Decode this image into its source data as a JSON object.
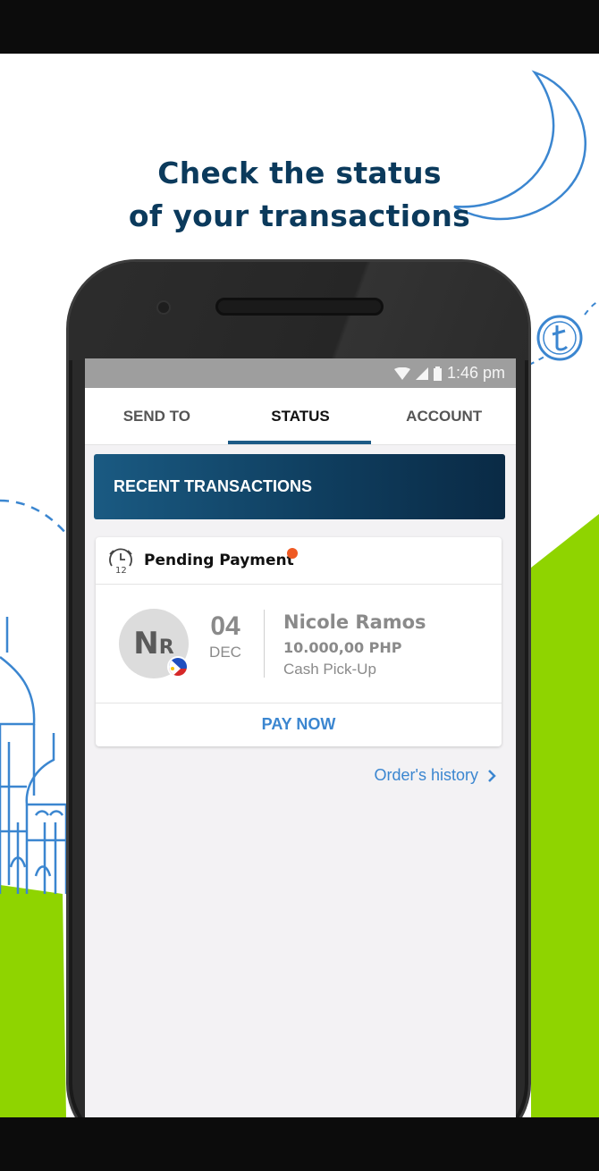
{
  "promo": {
    "line1": "Check the status",
    "line2": "of your transactions"
  },
  "status_bar": {
    "time": "1:46 pm",
    "icons": [
      "wifi-icon",
      "signal-icon",
      "battery-icon"
    ]
  },
  "tabs": [
    {
      "label": "SEND TO"
    },
    {
      "label": "STATUS",
      "active": true
    },
    {
      "label": "ACCOUNT"
    }
  ],
  "banner": {
    "title": "RECENT TRANSACTIONS"
  },
  "transaction": {
    "status_label": "Pending Payment",
    "status_icon": "clock-icon",
    "initials_1": "N",
    "initials_2": "R",
    "country_flag": "philippines-flag-icon",
    "day": "04",
    "month": "DEC",
    "recipient": "Nicole Ramos",
    "amount": "10.000,00 PHP",
    "method": "Cash Pick-Up",
    "action": "PAY NOW"
  },
  "history_link": {
    "label": "Order's history"
  },
  "colors": {
    "brand_blue": "#0b3a5c",
    "accent_green": "#8fd400",
    "link_blue": "#3b86d0",
    "pending_dot": "#ef5a24"
  }
}
